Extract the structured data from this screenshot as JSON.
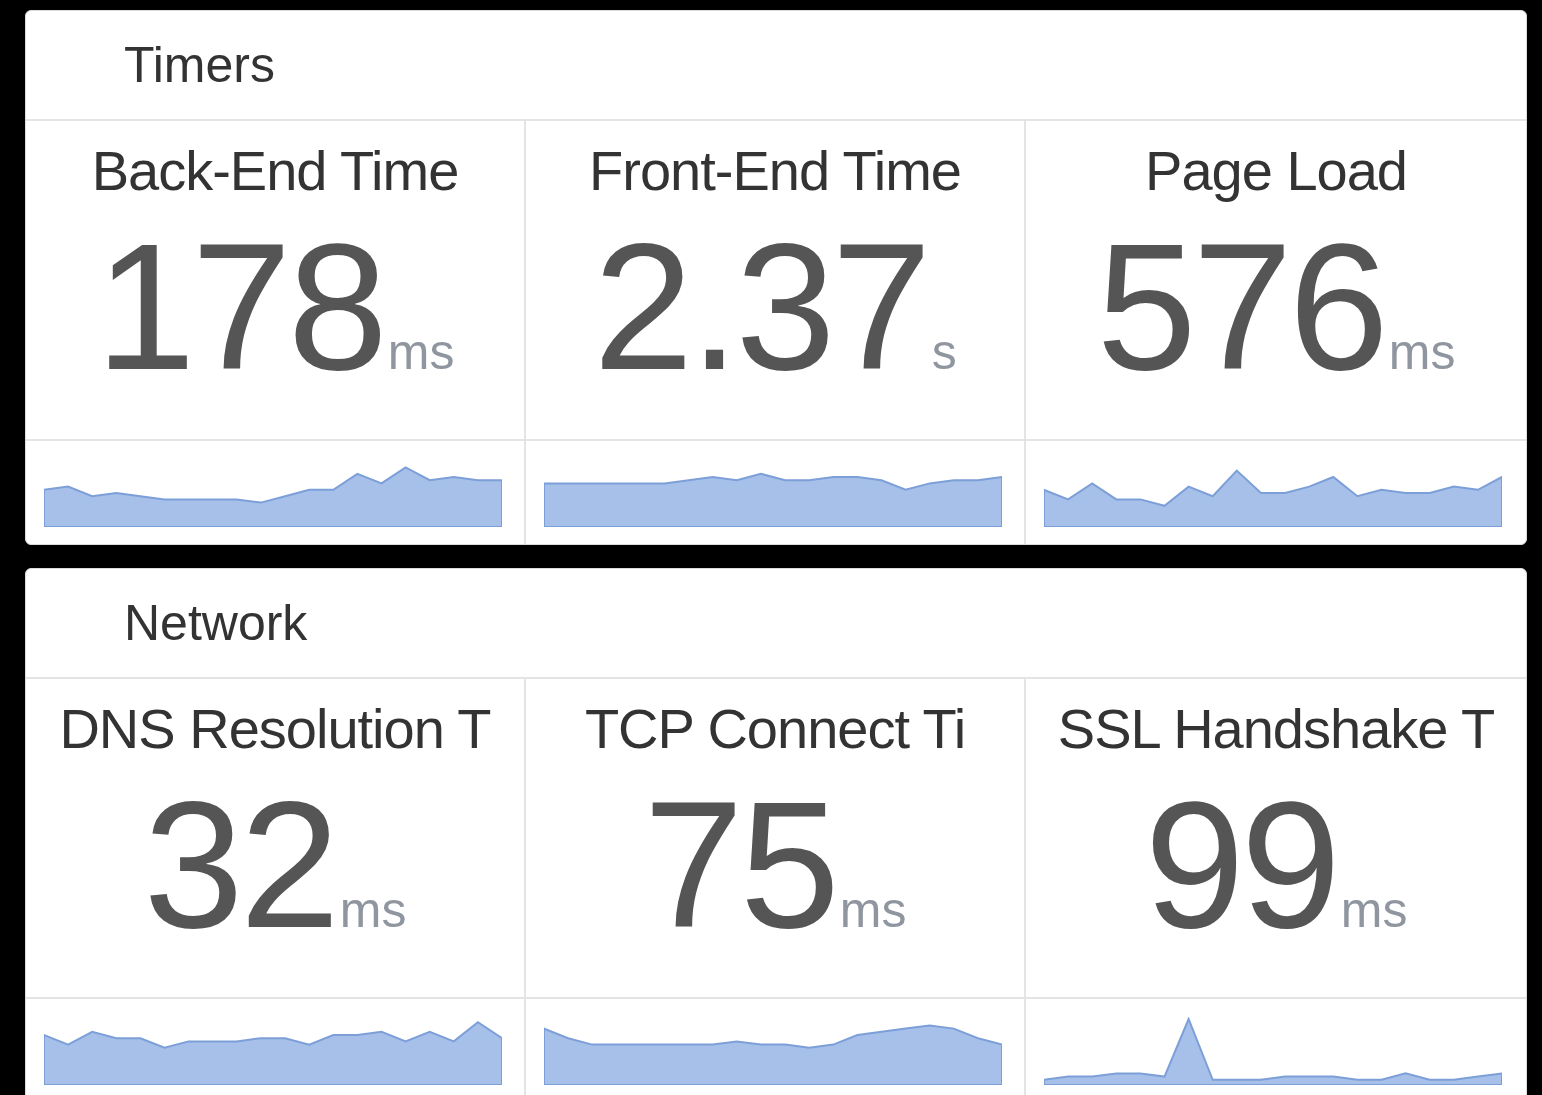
{
  "sections": [
    {
      "title": "Timers",
      "metrics": [
        {
          "label": "Back-End Time",
          "value": "178",
          "unit": "ms"
        },
        {
          "label": "Front-End Time",
          "value": "2.37",
          "unit": "s"
        },
        {
          "label": "Page Load",
          "value": "576",
          "unit": "ms"
        }
      ]
    },
    {
      "title": "Network",
      "metrics": [
        {
          "label": "DNS Resolution T",
          "value": "32",
          "unit": "ms"
        },
        {
          "label": "TCP Connect Ti",
          "value": "75",
          "unit": "ms"
        },
        {
          "label": "SSL Handshake T",
          "value": "99",
          "unit": "ms"
        }
      ]
    }
  ]
}
